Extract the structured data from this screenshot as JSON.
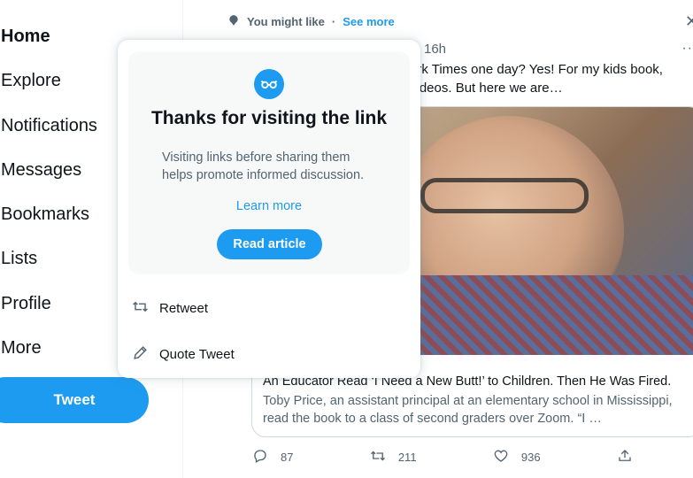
{
  "sidebar": {
    "items": [
      {
        "label": "Home",
        "active": true
      },
      {
        "label": "Explore"
      },
      {
        "label": "Notifications"
      },
      {
        "label": "Messages"
      },
      {
        "label": "Bookmarks"
      },
      {
        "label": "Lists"
      },
      {
        "label": "Profile"
      },
      {
        "label": "More"
      }
    ],
    "tweet_button": "Tweet"
  },
  "timeline": {
    "suggestion": {
      "label": "You might like",
      "separator": "·",
      "see_more": "See more"
    },
    "tweet": {
      "time": "16h",
      "text_line1": "ork Times one day? Yes! For my kids book,",
      "text_line2": "videos. But here we are…",
      "card": {
        "title": "An Educator Read ‘I Need a New Butt!’ to Children. Then He Was Fired.",
        "description": "Toby Price, an assistant principal at an elementary school in Mississippi, read the book to a class of second graders over Zoom. “I …"
      },
      "actions": {
        "replies": "87",
        "retweets": "211",
        "likes": "936"
      }
    }
  },
  "popover": {
    "title": "Thanks for visiting the link",
    "body": "Visiting links before sharing them helps promote informed discussion.",
    "learn_more": "Learn more",
    "read_article": "Read article",
    "retweet": "Retweet",
    "quote_tweet": "Quote Tweet"
  },
  "colors": {
    "accent": "#1d9bf0",
    "text": "#0f1419",
    "muted": "#536471"
  }
}
